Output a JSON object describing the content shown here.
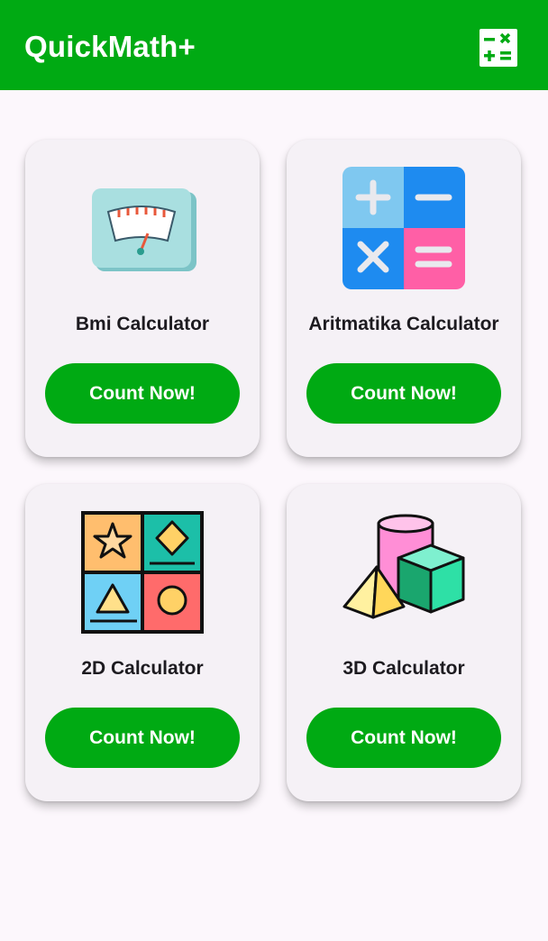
{
  "app": {
    "title": "QuickMath+",
    "brand_color": "#00aa13",
    "action_icon": "calculator-icon"
  },
  "cards": [
    {
      "title": "Bmi Calculator",
      "button_label": "Count Now!",
      "icon": "bmi-scale-icon"
    },
    {
      "title": "Aritmatika Calculator",
      "button_label": "Count Now!",
      "icon": "arithmetic-operators-icon"
    },
    {
      "title": "2D Calculator",
      "button_label": "Count Now!",
      "icon": "2d-shapes-icon"
    },
    {
      "title": "3D Calculator",
      "button_label": "Count Now!",
      "icon": "3d-shapes-icon"
    }
  ]
}
